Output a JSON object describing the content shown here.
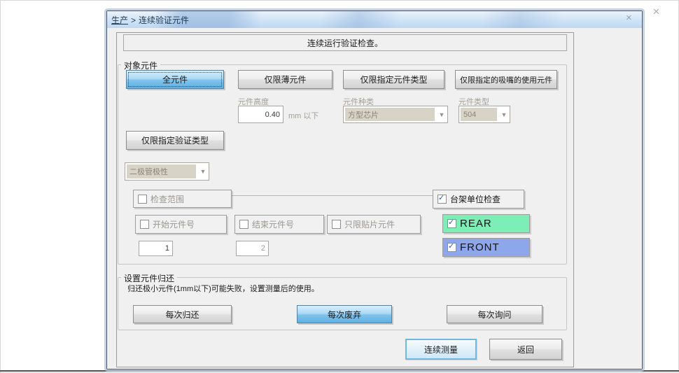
{
  "icons": {
    "check": "✓",
    "dropdown_arrow": "▼",
    "close": "✕"
  },
  "titlebar": {
    "breadcrumb_root": "生产",
    "breadcrumb_sep": ">",
    "title": "连续验证元件"
  },
  "header": {
    "text": "连续运行验证检查。"
  },
  "object_group": {
    "label": "对象元件",
    "filter_buttons": [
      {
        "label": "全元件",
        "selected": true
      },
      {
        "label": "仅限薄元件",
        "selected": false
      },
      {
        "label": "仅限指定元件类型",
        "selected": false
      },
      {
        "label": "仅限指定的吸嘴的使用元件",
        "selected": false
      }
    ],
    "height_field": {
      "label": "元件高度",
      "value": "0.40",
      "unit": "mm 以下"
    },
    "kind_field": {
      "label": "元件种类",
      "value": "方型芯片"
    },
    "type_field": {
      "label": "元件类型",
      "value": "504"
    },
    "verify_type_button": {
      "label": "仅限指定验证类型"
    },
    "polarity_dropdown": {
      "value": "二极管极性"
    },
    "check_range": {
      "label": "检查范围",
      "checked": false
    },
    "start_no": {
      "label": "开始元件号",
      "checked": false,
      "value": "1"
    },
    "end_no": {
      "label": "结束元件号",
      "checked": false,
      "value": "2"
    },
    "chip_only": {
      "label": "只限贴片元件",
      "checked": false
    },
    "stage_check": {
      "label": "台架单位检查",
      "checked": true
    },
    "stages": [
      {
        "label": "REAR",
        "checked": true,
        "color": "#7deeb5"
      },
      {
        "label": "FRONT",
        "checked": true,
        "color": "#8ea6ea"
      }
    ]
  },
  "return_group": {
    "label": "设置元件归还",
    "note": "归还极小元件(1mm以下)可能失败，设置测量后的使用。",
    "buttons": [
      {
        "label": "每次归还",
        "selected": false
      },
      {
        "label": "每次废弃",
        "selected": true
      },
      {
        "label": "每次询问",
        "selected": false
      }
    ]
  },
  "footer": {
    "measure_button": "连续测量",
    "back_button": "返回"
  },
  "colors": {
    "accent_blue": "#5fb0e2",
    "rear_green": "#7deeb5",
    "front_blue": "#8ea6ea"
  }
}
